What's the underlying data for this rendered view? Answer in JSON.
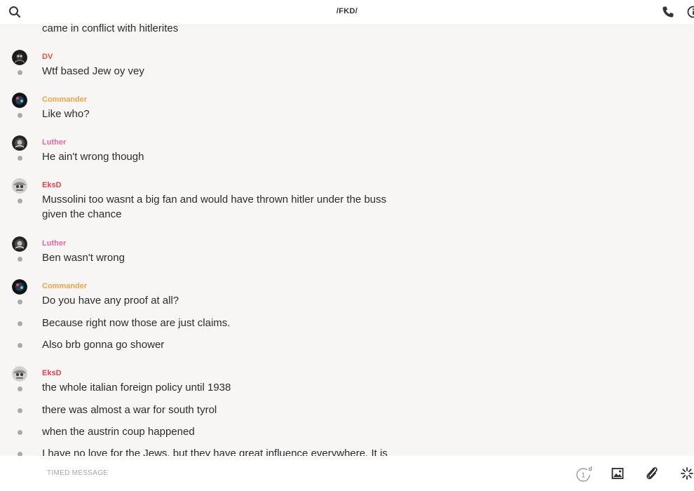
{
  "header": {
    "title": "/FKD/",
    "search_icon": "search-icon",
    "call_icon": "phone-icon",
    "info_icon": "info-icon"
  },
  "colors": {
    "DV": "#e0543f",
    "Commander": "#f0a24a",
    "Luther": "#e06aa0",
    "EksD": "#e0414f"
  },
  "messages": [
    {
      "text": "came in conflict with hitlerites"
    },
    {
      "sender": "DV",
      "text": "Wtf based Jew oy vey"
    },
    {
      "sender": "Commander",
      "text": "Like who?"
    },
    {
      "sender": "Luther",
      "text": "He ain't wrong though"
    },
    {
      "sender": "EksD",
      "text": "Mussolini too wasnt a big fan and would have thrown hitler under the buss",
      "text2": "given the chance"
    },
    {
      "sender": "Luther",
      "text": "Ben wasn't wrong"
    },
    {
      "sender": "Commander",
      "text": "Do you have any proof at all?"
    },
    {
      "text": "Because right now those are just claims."
    },
    {
      "text": "Also brb gonna go shower"
    },
    {
      "sender": "EksD",
      "text": "the whole italian foreign policy until 1938"
    },
    {
      "text": "there was almost a war for south tyrol"
    },
    {
      "text": "when the austrin coup happened"
    },
    {
      "text": "I have no love for the Jews, but they have great influence everywhere. It is"
    }
  ],
  "composer": {
    "placeholder": "TIMED MESSAGE",
    "timer_value": "1",
    "timer_unit": "d",
    "image_icon": "image-icon",
    "attach_icon": "paperclip-icon",
    "more_icon": "spinner-icon"
  }
}
